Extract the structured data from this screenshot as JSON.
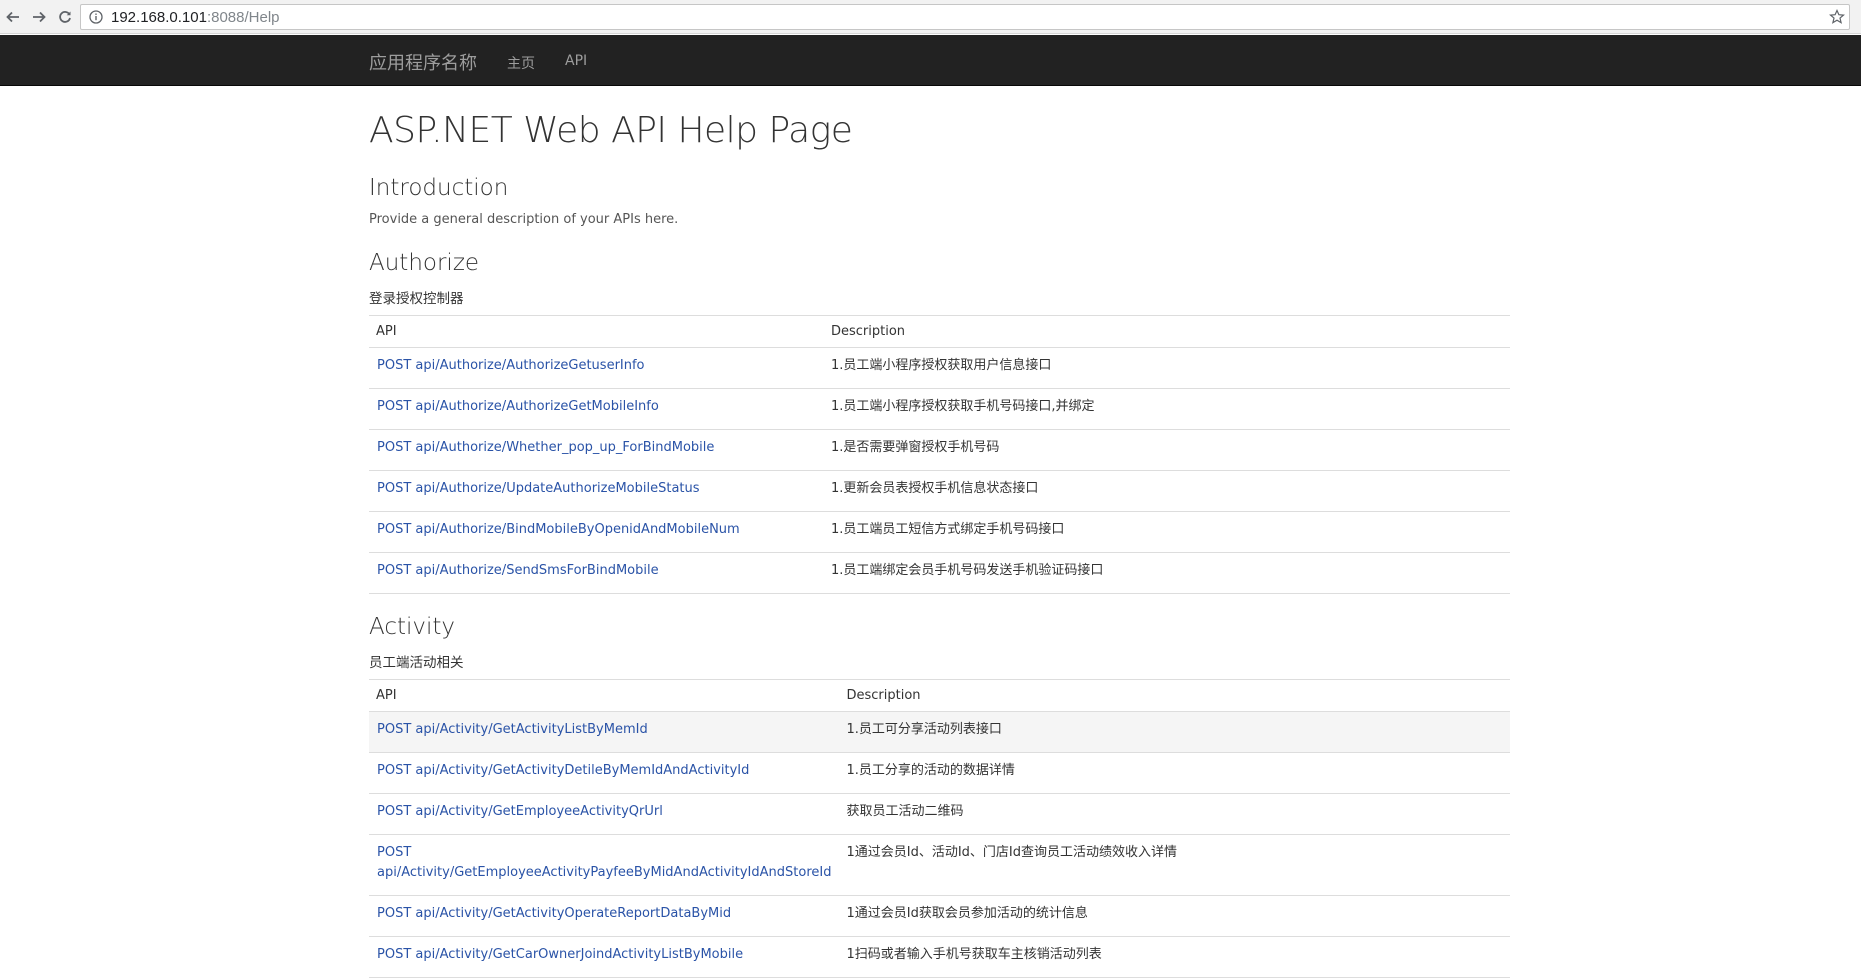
{
  "browser": {
    "url_host": "192.168.0.101",
    "url_path": ":8088/Help"
  },
  "navbar": {
    "brand": "应用程序名称",
    "links": [
      "主页",
      "API"
    ]
  },
  "page": {
    "title": "ASP.NET Web API Help Page",
    "intro_heading": "Introduction",
    "intro_text": "Provide a general description of your APIs here."
  },
  "sections": [
    {
      "name": "Authorize",
      "description": "登录授权控制器",
      "header_api": "API",
      "header_description": "Description",
      "rows": [
        {
          "api": "POST api/Authorize/AuthorizeGetuserInfo",
          "desc": "1.员工端小程序授权获取用户信息接口"
        },
        {
          "api": "POST api/Authorize/AuthorizeGetMobileInfo",
          "desc": "1.员工端小程序授权获取手机号码接口,并绑定"
        },
        {
          "api": "POST api/Authorize/Whether_pop_up_ForBindMobile",
          "desc": "1.是否需要弹窗授权手机号码"
        },
        {
          "api": "POST api/Authorize/UpdateAuthorizeMobileStatus",
          "desc": "1.更新会员表授权手机信息状态接口"
        },
        {
          "api": "POST api/Authorize/BindMobileByOpenidAndMobileNum",
          "desc": "1.员工端员工短信方式绑定手机号码接口"
        },
        {
          "api": "POST api/Authorize/SendSmsForBindMobile",
          "desc": "1.员工端绑定会员手机号码发送手机验证码接口"
        }
      ]
    },
    {
      "name": "Activity",
      "description": "员工端活动相关",
      "header_api": "API",
      "header_description": "Description",
      "rows": [
        {
          "api": "POST api/Activity/GetActivityListByMemId",
          "desc": "1.员工可分享活动列表接口"
        },
        {
          "api": "POST api/Activity/GetActivityDetileByMemIdAndActivityId",
          "desc": "1.员工分享的活动的数据详情"
        },
        {
          "api": "POST api/Activity/GetEmployeeActivityQrUrl",
          "desc": "获取员工活动二维码"
        },
        {
          "api": "POST api/Activity/GetEmployeeActivityPayfeeByMidAndActivityIdAndStoreId",
          "api_line1": "POST",
          "api_line2": "api/Activity/GetEmployeeActivityPayfeeByMidAndActivityIdAndStoreId",
          "desc": "1通过会员Id、活动Id、门店Id查询员工活动绩效收入详情"
        },
        {
          "api": "POST api/Activity/GetActivityOperateReportDataByMid",
          "desc": "1通过会员Id获取会员参加活动的统计信息"
        },
        {
          "api": "POST api/Activity/GetCarOwnerJoindActivityListByMobile",
          "desc": "1扫码或者输入手机号获取车主核销活动列表"
        }
      ]
    }
  ]
}
